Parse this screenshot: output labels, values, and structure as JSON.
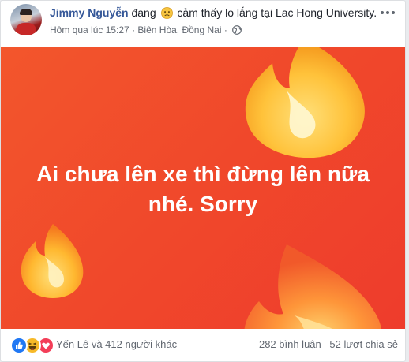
{
  "post": {
    "author": "Jimmy Nguyễn",
    "status_verb": "đang",
    "feeling": "cảm thấy lo lắng",
    "at_word": "tại",
    "place": "Lac Hong University.",
    "time": "Hôm qua lúc 15:27",
    "separator": "·",
    "location": "Biên Hòa, Đồng Nai",
    "separator2": "·",
    "privacy_icon": "globe-icon",
    "feeling_icon": "worried-face-icon",
    "image_text_line1": "Ai chưa lên xe thì đừng lên nữa",
    "image_text_line2": "nhé. Sorry",
    "image_bg_color": "#f0482b"
  },
  "footer": {
    "reaction_icons": [
      "like-icon",
      "haha-icon",
      "love-icon"
    ],
    "reactors": "Yến Lê và 412 người khác",
    "comments": "282 bình luận",
    "shares": "52 lượt chia sẻ"
  },
  "colors": {
    "author_link": "#365899",
    "like_blue": "#2078f4",
    "haha_yellow": "#f7b928",
    "love_red": "#f33e58"
  }
}
